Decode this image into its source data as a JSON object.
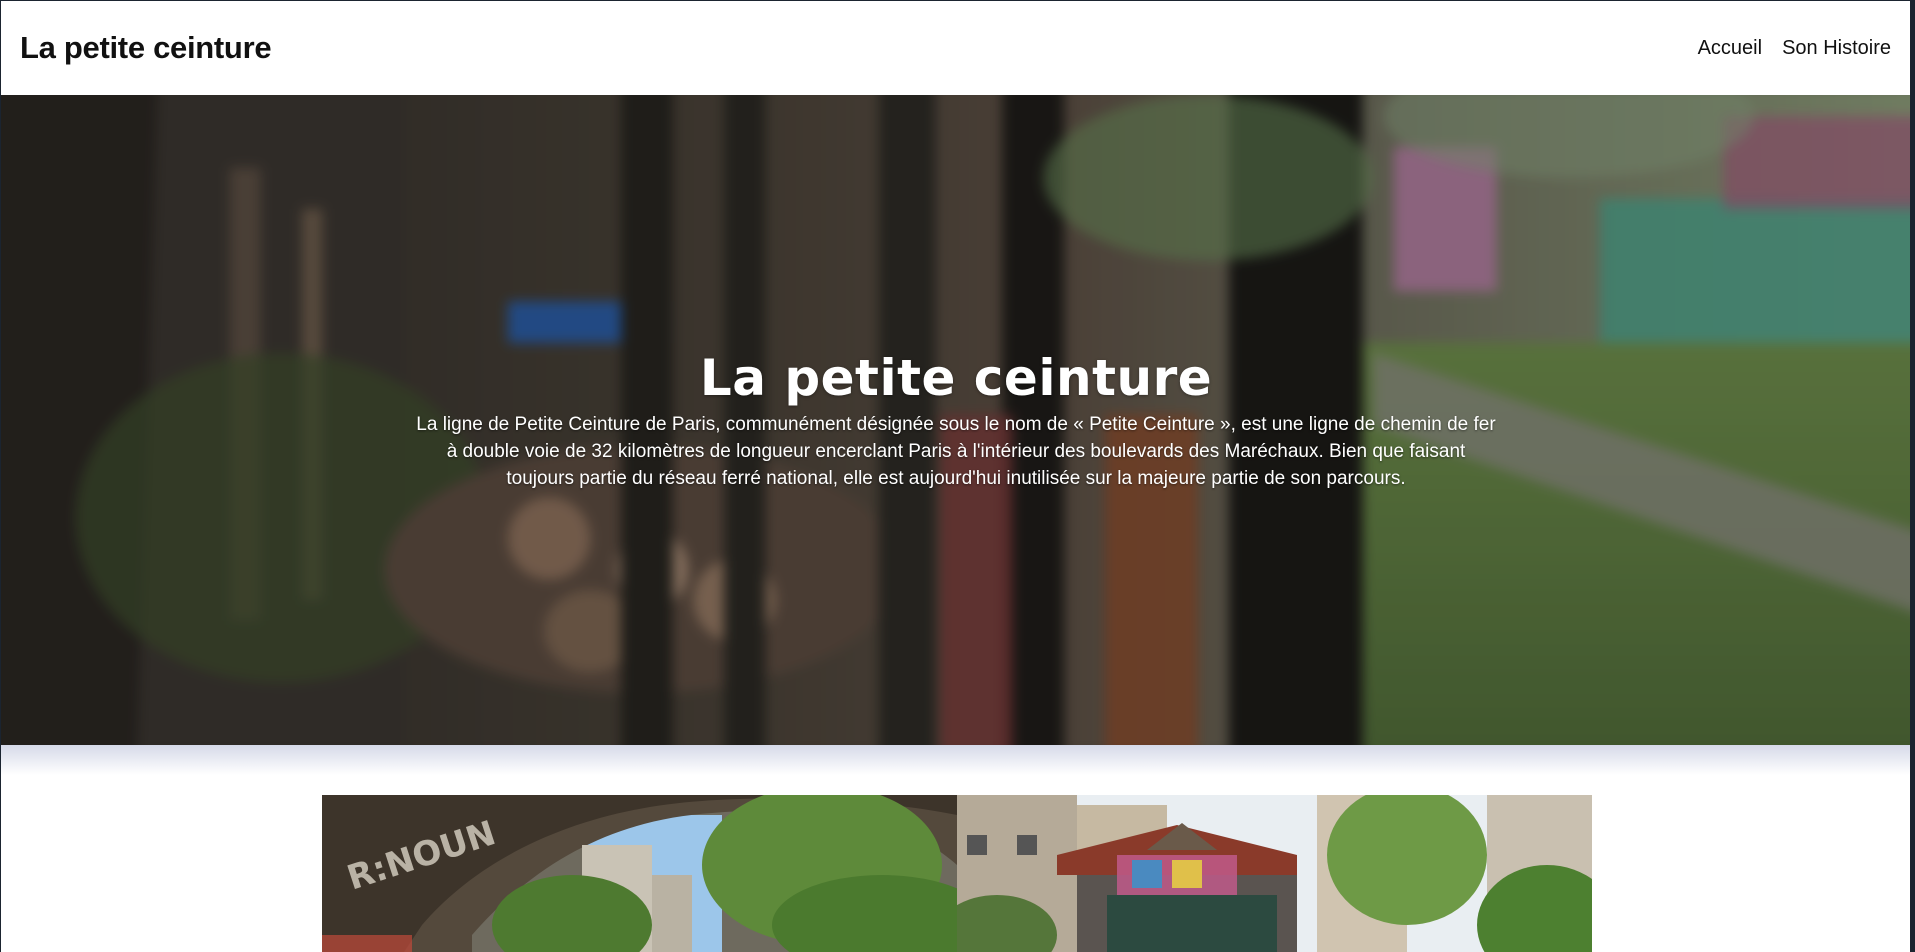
{
  "header": {
    "brand": "La petite ceinture",
    "nav": [
      {
        "label": "Accueil"
      },
      {
        "label": "Son Histoire"
      }
    ]
  },
  "hero": {
    "title": "La petite ceinture",
    "description": "La ligne de Petite Ceinture de Paris, communément désignée sous le nom de « Petite Ceinture », est une ligne de chemin de fer à double voie de 32 kilomètres de longueur encerclant Paris à l'intérieur des boulevards des Maréchaux. Bien que faisant toujours partie du réseau ferré national, elle est aujourd'hui inutilisée sur la majeure partie de son parcours."
  },
  "gallery": {
    "items": [
      {
        "subject": "stone arch bridge over overgrown railway"
      },
      {
        "subject": "graffiti-covered station building among trees"
      }
    ]
  },
  "colors": {
    "text": "#111111",
    "hero_text": "#ffffff",
    "frame": "#1b2430"
  }
}
